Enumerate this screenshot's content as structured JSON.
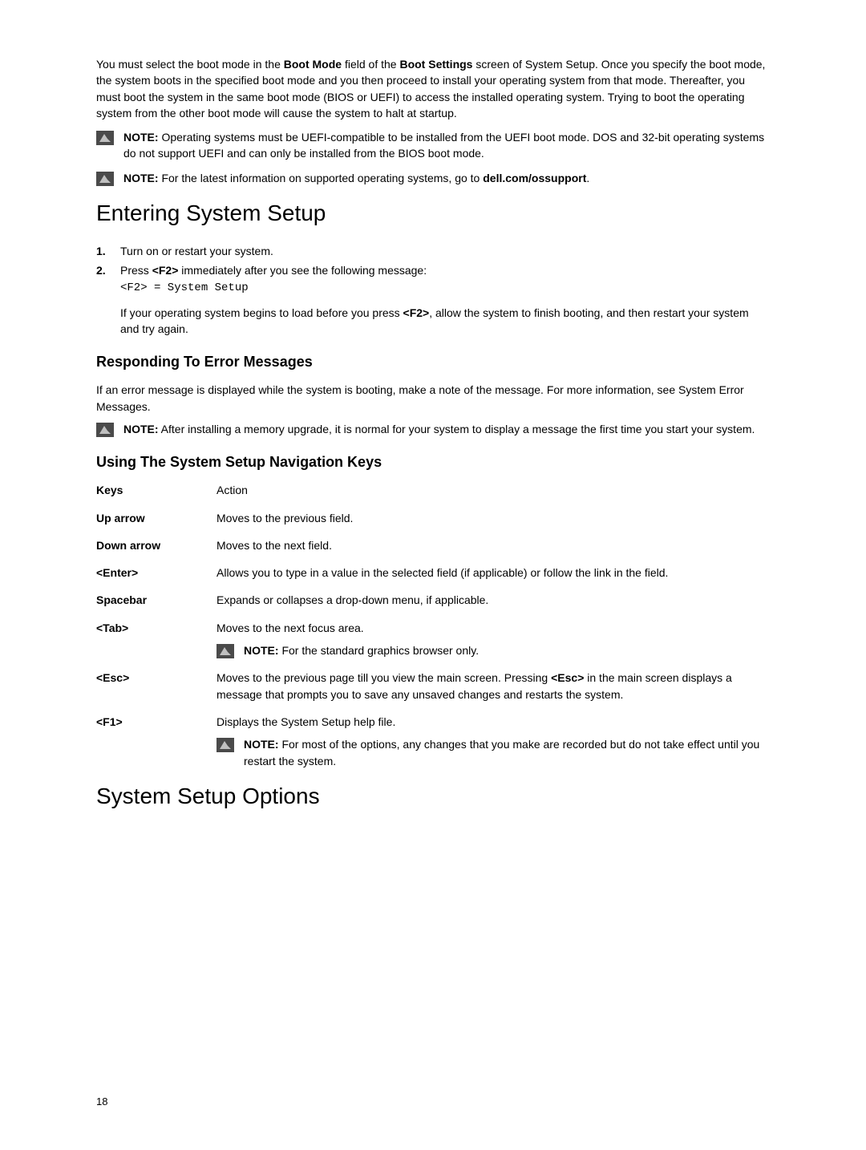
{
  "intro": "You must select the boot mode in the Boot Mode field of the Boot Settings screen of System Setup. Once you specify the boot mode, the system boots in the specified boot mode and you then proceed to install your operating system from that mode. Thereafter, you must boot the system in the same boot mode (BIOS or UEFI) to access the installed operating system. Trying to boot the operating system from the other boot mode will cause the system to halt at startup.",
  "intro_bold1": "Boot Mode",
  "intro_bold2": "Boot Settings",
  "note1": {
    "label": "NOTE:",
    "text": " Operating systems must be UEFI-compatible to be installed from the UEFI boot mode. DOS and 32-bit operating systems do not support UEFI and can only be installed from the BIOS boot mode."
  },
  "note2": {
    "label": "NOTE:",
    "text_before": " For the latest information on supported operating systems, go to ",
    "bold_link": "dell.com/ossupport",
    "text_after": "."
  },
  "h1_entering": "Entering System Setup",
  "step1": "Turn on or restart your system.",
  "step2_before": "Press ",
  "step2_key": "<F2>",
  "step2_after": " immediately after you see the following message:",
  "step2_code": "<F2> = System Setup",
  "step_followup_before": "If your operating system begins to load before you press ",
  "step_followup_key": "<F2>",
  "step_followup_after": ", allow the system to finish booting, and then restart your system and try again.",
  "h2_responding": "Responding To Error Messages",
  "responding_para": "If an error message is displayed while the system is booting, make a note of the message. For more information, see System Error Messages.",
  "note3": {
    "label": "NOTE:",
    "text": " After installing a memory upgrade, it is normal for your system to display a message the first time you start your system."
  },
  "h2_using": "Using The System Setup Navigation Keys",
  "table_header": {
    "keys": "Keys",
    "action": "Action"
  },
  "rows": {
    "uparrow": {
      "key": "Up arrow",
      "action": "Moves to the previous field."
    },
    "downarrow": {
      "key": "Down arrow",
      "action": "Moves to the next field."
    },
    "enter": {
      "key": "<Enter>",
      "action": "Allows you to type in a value in the selected field (if applicable) or follow the link in the field."
    },
    "spacebar": {
      "key": "Spacebar",
      "action": "Expands or collapses a drop-down menu, if applicable."
    },
    "tab": {
      "key": "<Tab>",
      "action": "Moves to the next focus area."
    },
    "tab_note": {
      "label": "NOTE:",
      "text": " For the standard graphics browser only."
    },
    "esc": {
      "key": "<Esc>",
      "action_before": "Moves to the previous page till you view the main screen. Pressing ",
      "action_key": "<Esc>",
      "action_after": " in the main screen displays a message that prompts you to save any unsaved changes and restarts the system."
    },
    "f1": {
      "key": "<F1>",
      "action": "Displays the System Setup help file."
    },
    "f1_note": {
      "label": "NOTE:",
      "text": " For most of the options, any changes that you make are recorded but do not take effect until you restart the system."
    }
  },
  "h1_options": "System Setup Options",
  "page_number": "18"
}
